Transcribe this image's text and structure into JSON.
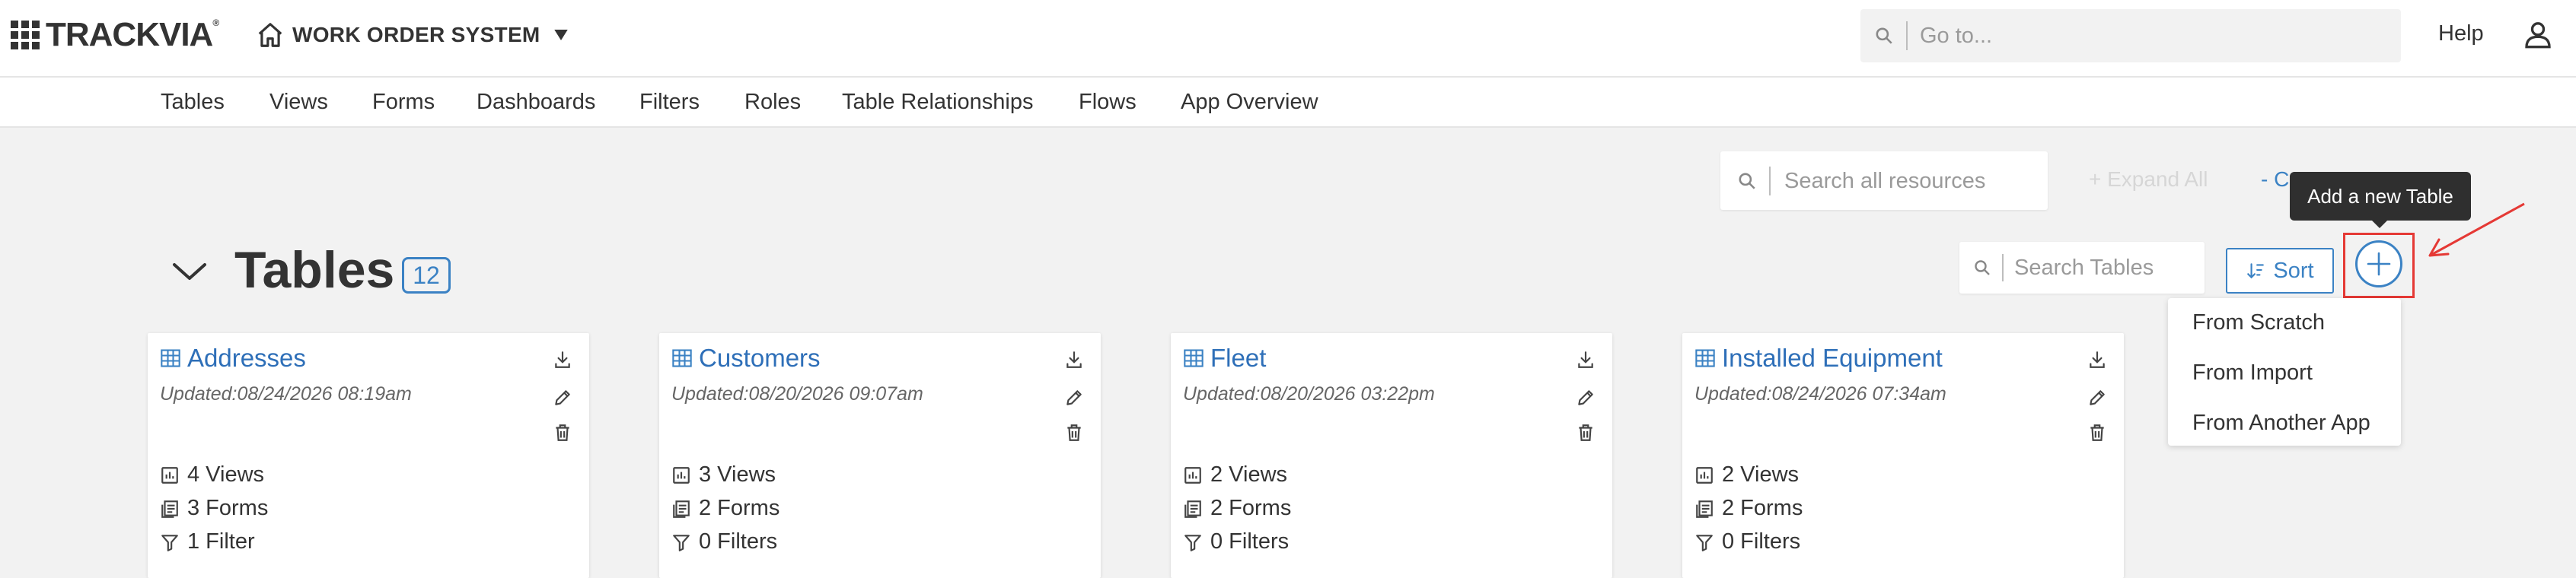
{
  "header": {
    "logo_text": "TRACKVIA",
    "logo_mark": "®",
    "app_name": "WORK ORDER SYSTEM",
    "goto_placeholder": "Go to...",
    "help_label": "Help"
  },
  "nav": {
    "items": [
      {
        "label": "Tables"
      },
      {
        "label": "Views"
      },
      {
        "label": "Forms"
      },
      {
        "label": "Dashboards"
      },
      {
        "label": "Filters"
      },
      {
        "label": "Roles"
      },
      {
        "label": "Table Relationships"
      },
      {
        "label": "Flows"
      },
      {
        "label": "App Overview"
      }
    ]
  },
  "toolbar": {
    "search_all_placeholder": "Search all resources",
    "expand_all": "+ Expand All",
    "collapse_all": "- C",
    "tooltip": "Add a new Table"
  },
  "section": {
    "title": "Tables",
    "count": "12",
    "search_placeholder": "Search Tables",
    "sort_label": "Sort"
  },
  "add_menu": {
    "items": [
      {
        "label": "From Scratch"
      },
      {
        "label": "From Import"
      },
      {
        "label": "From Another App"
      }
    ]
  },
  "cards": [
    {
      "title": "Addresses",
      "updated": "Updated:08/24/2026 08:19am",
      "views": "4 Views",
      "forms": "3 Forms",
      "filters": "1 Filter"
    },
    {
      "title": "Customers",
      "updated": "Updated:08/20/2026 09:07am",
      "views": "3 Views",
      "forms": "2 Forms",
      "filters": "0 Filters"
    },
    {
      "title": "Fleet",
      "updated": "Updated:08/20/2026 03:22pm",
      "views": "2 Views",
      "forms": "2 Forms",
      "filters": "0 Filters"
    },
    {
      "title": "Installed Equipment",
      "updated": "Updated:08/24/2026 07:34am",
      "views": "2 Views",
      "forms": "2 Forms",
      "filters": "0 Filters"
    }
  ],
  "colors": {
    "accent": "#3b82c4",
    "link": "#2e6fb8",
    "annotation": "#e53935",
    "tooltip_bg": "#2f2f2f",
    "page_bg": "#f2f2f2"
  }
}
